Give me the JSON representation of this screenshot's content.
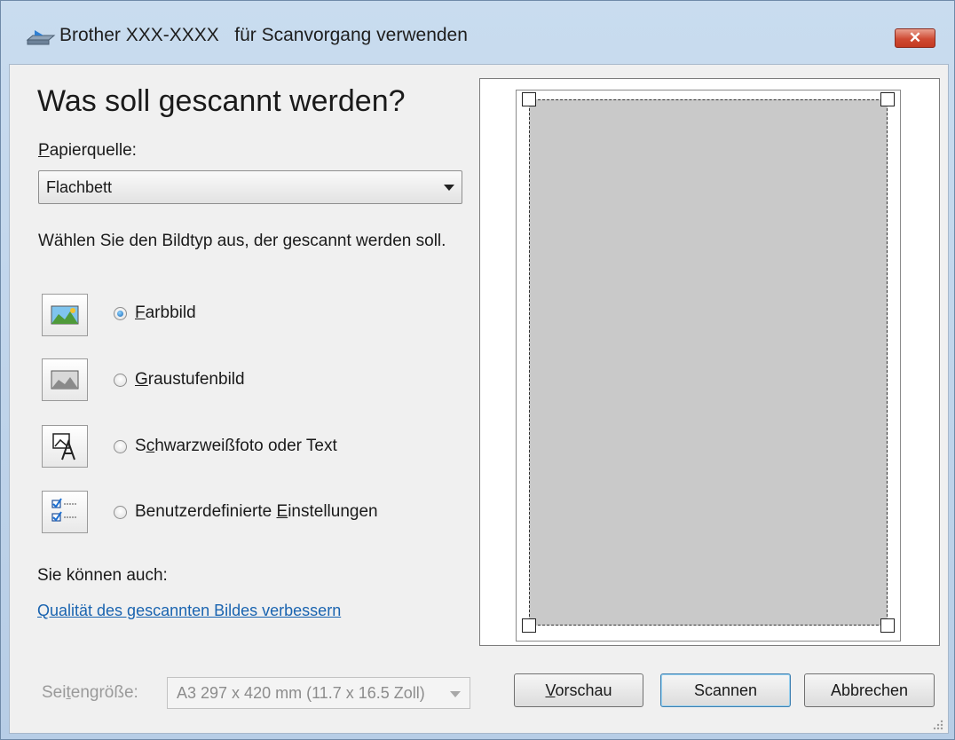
{
  "window": {
    "title": "Brother XXX-XXXX   für Scanvorgang verwenden",
    "close_label": "✕"
  },
  "heading": "Was soll gescannt werden?",
  "paper_source": {
    "label_accel": "P",
    "label_rest": "apierquelle:",
    "value": "Flachbett"
  },
  "image_type_prompt": "Wählen Sie den Bildtyp aus, der gescannt werden soll.",
  "image_types": [
    {
      "icon": "color-photo-icon",
      "pre": "",
      "accel": "F",
      "post": "arbbild",
      "selected": true
    },
    {
      "icon": "grayscale-photo-icon",
      "pre": "",
      "accel": "G",
      "post": "raustufenbild",
      "selected": false
    },
    {
      "icon": "bw-text-icon",
      "pre": "S",
      "accel": "c",
      "post": "hwarzweißfoto oder Text",
      "selected": false
    },
    {
      "icon": "custom-settings-icon",
      "pre": "Benutzerdefinierte ",
      "accel": "E",
      "post": "instellungen",
      "selected": false
    }
  ],
  "also_label": "Sie können auch:",
  "improve_link": "Qualität des gescannten Bildes verbessern",
  "page_size": {
    "label_pre": "Sei",
    "label_accel": "t",
    "label_post": "engröße:",
    "value": "A3 297 x 420 mm (11.7 x 16.5 Zoll)"
  },
  "buttons": {
    "preview_accel": "V",
    "preview_rest": "orschau",
    "scan": "Scannen",
    "cancel": "Abbrechen"
  },
  "colors": {
    "link": "#1a64b0",
    "titlebar": "#c9dcef",
    "close": "#cf4a33",
    "scan_area": "#c9c9c9"
  }
}
